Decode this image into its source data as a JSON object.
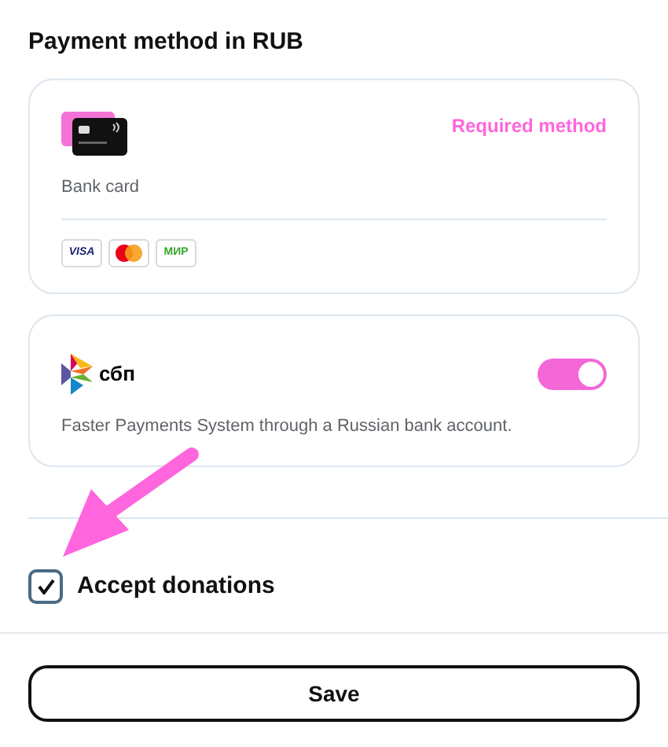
{
  "title": "Payment method in RUB",
  "methods": [
    {
      "kind": "card",
      "badge": "Required method",
      "label": "Bank card",
      "brands": [
        {
          "kind": "visa",
          "text": "VISA"
        },
        {
          "kind": "mastercard"
        },
        {
          "kind": "mir",
          "text": "МИР"
        }
      ]
    },
    {
      "kind": "sbp",
      "logo_text": "сбп",
      "on": true,
      "description": "Faster Payments System through a Russian bank account."
    }
  ],
  "donations": {
    "label": "Accept donations",
    "checked": true
  },
  "save_button": "Save"
}
